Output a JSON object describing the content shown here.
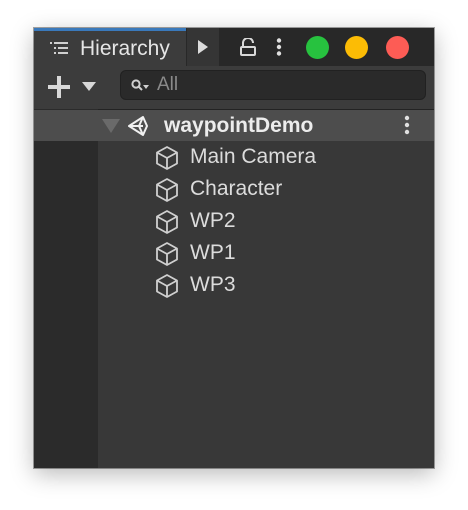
{
  "panel": {
    "title": "Hierarchy",
    "accent_color": "#3a79bb"
  },
  "window_controls": [
    {
      "name": "green-window-button",
      "color": "#27c23f"
    },
    {
      "name": "yellow-window-button",
      "color": "#fcbc05"
    },
    {
      "name": "red-window-button",
      "color": "#fd5c55"
    }
  ],
  "toolbar": {
    "add_icon": "plus-icon",
    "add_dropdown_icon": "caret-down-icon",
    "search_icon": "search-icon",
    "search_placeholder": "All"
  },
  "scene": {
    "name": "waypointDemo",
    "icon": "unity-icon",
    "expanded": true,
    "children": [
      {
        "label": "Main Camera",
        "icon": "cube-icon"
      },
      {
        "label": "Character",
        "icon": "cube-icon"
      },
      {
        "label": "WP2",
        "icon": "cube-icon"
      },
      {
        "label": "WP1",
        "icon": "cube-icon"
      },
      {
        "label": "WP3",
        "icon": "cube-icon"
      }
    ]
  }
}
